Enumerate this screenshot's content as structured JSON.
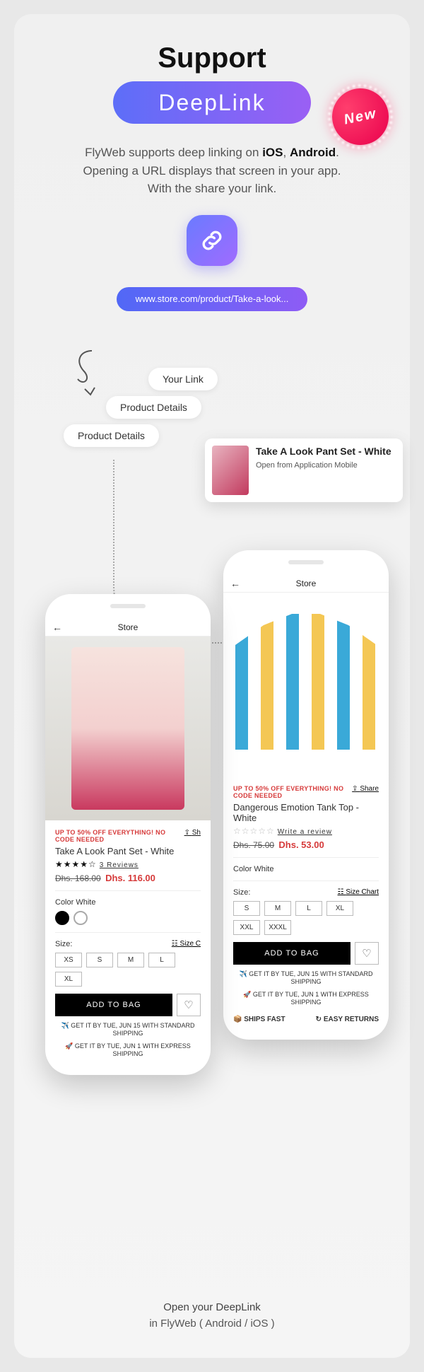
{
  "header": {
    "support": "Support",
    "deeplink": "DeepLink",
    "new_badge": "New"
  },
  "description": {
    "line1a": "FlyWeb supports deep linking on ",
    "ios": "iOS",
    "sep": ", ",
    "android": "Android",
    "period": ".",
    "line2": "Opening a URL displays that screen in your app.",
    "line3": "With the share your link."
  },
  "url": "www.store.com/product/Take-a-look...",
  "labels": {
    "your_link": "Your Link",
    "product_details": "Product Details"
  },
  "note": {
    "title": "Take A Look Pant Set - White",
    "subtitle": "Open from Application Mobile"
  },
  "store_title": "Store",
  "promo_text": "UP TO 50% OFF EVERYTHING! NO CODE NEEDED",
  "share": "Share",
  "phone_left": {
    "title": "Take A Look Pant Set - White",
    "reviews_count": "3 Reviews",
    "price_old": "Dhs. 168.00",
    "price_new": "Dhs. 116.00",
    "color_label": "Color White",
    "size_label": "Size:",
    "size_chart": "Size Chart",
    "sizes": [
      "XS",
      "S",
      "M",
      "L",
      "XL"
    ],
    "add_to_bag": "ADD TO BAG",
    "ship1": "✈️ GET IT BY TUE, JUN 15 WITH STANDARD SHIPPING",
    "ship2": "🚀 GET IT BY TUE, JUN 1 WITH EXPRESS SHIPPING"
  },
  "phone_right": {
    "title": "Dangerous Emotion Tank Top - White",
    "write_review": "Write a review",
    "price_old": "Dhs. 75.00",
    "price_new": "Dhs. 53.00",
    "color_label": "Color White",
    "size_label": "Size:",
    "size_chart": "Size Chart",
    "sizes": [
      "S",
      "M",
      "L",
      "XL",
      "XXL",
      "XXXL"
    ],
    "add_to_bag": "ADD TO BAG",
    "ship1": "✈️ GET IT BY TUE, JUN 15 WITH STANDARD SHIPPING",
    "ship2": "🚀 GET IT BY TUE, JUN 1 WITH EXPRESS SHIPPING",
    "ships_fast": "SHIPS FAST",
    "easy_returns": "EASY RETURNS"
  },
  "footer": {
    "line1": "Open your DeepLink",
    "line2": "in FlyWeb ( Android / iOS )"
  }
}
